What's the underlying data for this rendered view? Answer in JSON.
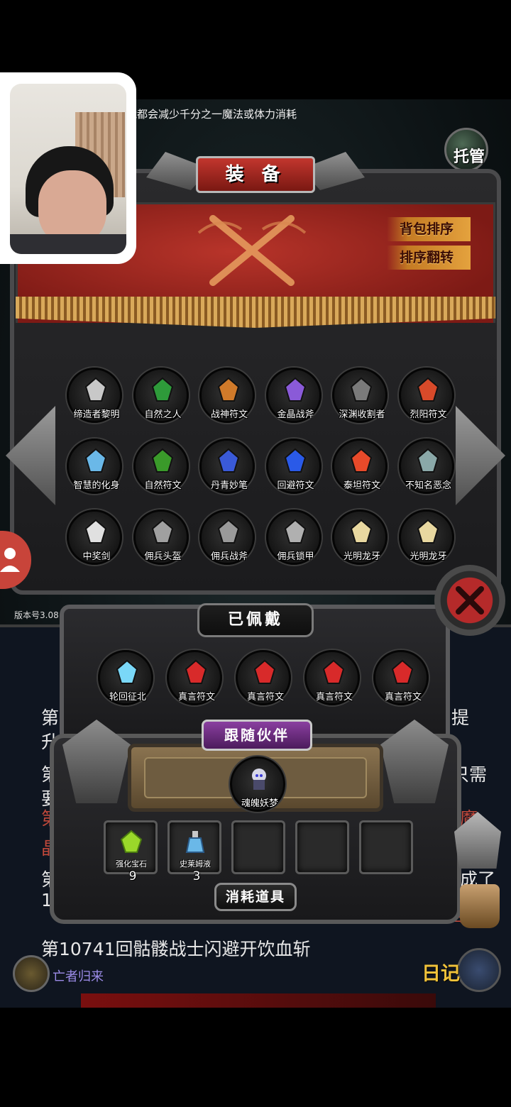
{
  "status_message": "能都会减少千分之一魔法或体力消耗",
  "host_button": "托管",
  "version": "版本号3.08",
  "equipment": {
    "title": "装 备",
    "sort_bag": "背包排序",
    "sort_reverse": "排序翻转",
    "items": [
      {
        "label": "缔造者黎明",
        "color": "#c8c8c8"
      },
      {
        "label": "自然之人",
        "color": "#2e9a3a"
      },
      {
        "label": "战神符文",
        "color": "#d07a2a"
      },
      {
        "label": "金晶战斧",
        "color": "#8a5ad8"
      },
      {
        "label": "深渊收割者",
        "color": "#7a7a7a"
      },
      {
        "label": "烈阳符文",
        "color": "#d84a2a"
      },
      {
        "label": "智慧的化身",
        "color": "#6ab8e8"
      },
      {
        "label": "自然符文",
        "color": "#3a9a2a"
      },
      {
        "label": "丹青妙笔",
        "color": "#3a5ad8"
      },
      {
        "label": "回避符文",
        "color": "#2a5ae8"
      },
      {
        "label": "泰坦符文",
        "color": "#e84a2a"
      },
      {
        "label": "不知名恶念",
        "color": "#8aa8a8"
      },
      {
        "label": "中奖剑",
        "color": "#e0e0e0"
      },
      {
        "label": "佣兵头盔",
        "color": "#a0a0a0"
      },
      {
        "label": "佣兵战斧",
        "color": "#9a9a9a"
      },
      {
        "label": "佣兵锁甲",
        "color": "#b0b0b0"
      },
      {
        "label": "光明龙牙",
        "color": "#e8d8a0"
      },
      {
        "label": "光明龙牙",
        "color": "#e8d8a0"
      }
    ]
  },
  "worn": {
    "title": "已佩戴",
    "items": [
      {
        "label": "轮回征北",
        "color": "#7ad8f8"
      },
      {
        "label": "真言符文",
        "color": "#d82a2a"
      },
      {
        "label": "真言符文",
        "color": "#d82a2a"
      },
      {
        "label": "真言符文",
        "color": "#d82a2a"
      },
      {
        "label": "真言符文",
        "color": "#d82a2a"
      }
    ]
  },
  "companion": {
    "title": "跟随伙伴",
    "name": "魂魄妖梦"
  },
  "consumables": {
    "title": "消耗道具",
    "items": [
      {
        "label": "强化宝石",
        "count": "9",
        "color": "#9ad82a"
      },
      {
        "label": "史莱姆液",
        "count": "3",
        "color": "#6ab8e8"
      }
    ]
  },
  "log": {
    "lines": [
      {
        "text": "第",
        "right": "提"
      },
      {
        "text": "升"
      },
      {
        "text": "第",
        "right": "只需"
      },
      {
        "text": "要"
      },
      {
        "text": "第",
        "right": "魔"
      },
      {
        "text": "晶",
        "right": "品"
      },
      {
        "text": "第",
        "right": "成了"
      },
      {
        "text": "1",
        "right": "吾"
      },
      {
        "text": "第10741回骷髅战士闪避开饮血斩"
      }
    ]
  },
  "bottom": {
    "undead_label": "亡者归来",
    "diary": "日记"
  }
}
